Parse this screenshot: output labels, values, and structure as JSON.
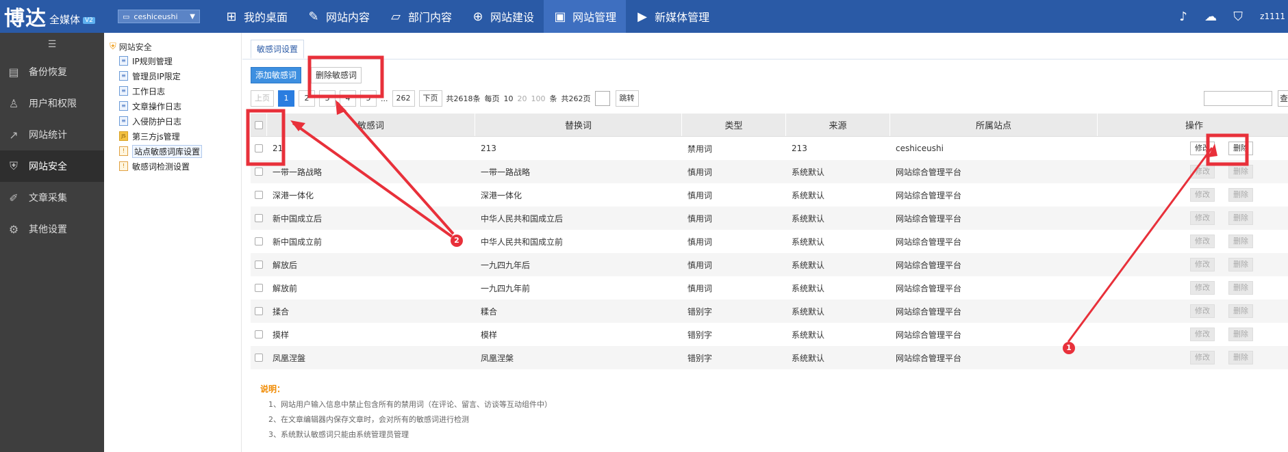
{
  "header": {
    "logo_main": "博达",
    "logo_sub": "全媒体",
    "logo_version": "V2",
    "site_selector": "ceshiceushi",
    "nav": [
      {
        "label": "我的桌面",
        "icon": "grid-icon"
      },
      {
        "label": "网站内容",
        "icon": "edit-icon"
      },
      {
        "label": "部门内容",
        "icon": "folder-icon"
      },
      {
        "label": "网站建设",
        "icon": "build-icon"
      },
      {
        "label": "网站管理",
        "icon": "monitor-icon",
        "active": true
      },
      {
        "label": "新媒体管理",
        "icon": "media-icon"
      }
    ],
    "username": "z1111"
  },
  "sidebar": {
    "items": [
      {
        "label": "备份恢复",
        "icon": "backup-icon"
      },
      {
        "label": "用户和权限",
        "icon": "user-icon"
      },
      {
        "label": "网站统计",
        "icon": "chart-icon"
      },
      {
        "label": "网站安全",
        "icon": "shield-icon",
        "active": true
      },
      {
        "label": "文章采集",
        "icon": "collect-icon"
      },
      {
        "label": "其他设置",
        "icon": "gear-icon"
      }
    ]
  },
  "tree": {
    "root": "网站安全",
    "items": [
      {
        "label": "IP规则管理",
        "icon": "doc-icon"
      },
      {
        "label": "管理员IP限定",
        "icon": "doc-icon"
      },
      {
        "label": "工作日志",
        "icon": "log-icon"
      },
      {
        "label": "文章操作日志",
        "icon": "log-icon"
      },
      {
        "label": "入侵防护日志",
        "icon": "log-icon"
      },
      {
        "label": "第三方js管理",
        "icon": "js-icon"
      },
      {
        "label": "站点敏感词库设置",
        "icon": "warn-icon",
        "selected": true
      },
      {
        "label": "敏感词检测设置",
        "icon": "warn-icon"
      }
    ]
  },
  "main": {
    "tab": "敏感词设置",
    "add_button": "添加敏感词",
    "delete_button": "删除敏感词",
    "pager": {
      "prev": "上页",
      "pages": [
        "1",
        "2",
        "3",
        "4",
        "5"
      ],
      "ellipsis": "...",
      "last": "262",
      "next": "下页",
      "total_text": "共2618条",
      "per_page_label": "每页",
      "sizes": [
        "10",
        "20",
        "100"
      ],
      "unit": "条",
      "pages_text": "共262页",
      "jump": "跳转"
    },
    "search_button": "查"
  },
  "table": {
    "headers": [
      "敏感词",
      "替换词",
      "类型",
      "来源",
      "所属站点",
      "操作"
    ],
    "edit_label": "修改",
    "delete_label": "删除",
    "rows": [
      {
        "word": "21",
        "replace": "213",
        "type": "禁用词",
        "source": "213",
        "site": "ceshiceushi",
        "enabled": true
      },
      {
        "word": "一带一路战略",
        "replace": "一带一路战略",
        "type": "慎用词",
        "source": "系统默认",
        "site": "网站综合管理平台",
        "enabled": false
      },
      {
        "word": "深港一体化",
        "replace": "深港一体化",
        "type": "慎用词",
        "source": "系统默认",
        "site": "网站综合管理平台",
        "enabled": false
      },
      {
        "word": "新中国成立后",
        "replace": "中华人民共和国成立后",
        "type": "慎用词",
        "source": "系统默认",
        "site": "网站综合管理平台",
        "enabled": false
      },
      {
        "word": "新中国成立前",
        "replace": "中华人民共和国成立前",
        "type": "慎用词",
        "source": "系统默认",
        "site": "网站综合管理平台",
        "enabled": false
      },
      {
        "word": "解放后",
        "replace": "一九四九年后",
        "type": "慎用词",
        "source": "系统默认",
        "site": "网站综合管理平台",
        "enabled": false
      },
      {
        "word": "解放前",
        "replace": "一九四九年前",
        "type": "慎用词",
        "source": "系统默认",
        "site": "网站综合管理平台",
        "enabled": false
      },
      {
        "word": "揉合",
        "replace": "糅合",
        "type": "错别字",
        "source": "系统默认",
        "site": "网站综合管理平台",
        "enabled": false
      },
      {
        "word": "摸样",
        "replace": "模样",
        "type": "错别字",
        "source": "系统默认",
        "site": "网站综合管理平台",
        "enabled": false
      },
      {
        "word": "凤凰涅盤",
        "replace": "凤凰涅槃",
        "type": "错别字",
        "source": "系统默认",
        "site": "网站综合管理平台",
        "enabled": false
      }
    ]
  },
  "notes": {
    "title": "说明：",
    "lines": [
      "1、网站用户输入信息中禁止包含所有的禁用词（在评论、留言、访谈等互动组件中）",
      "2、在文章编辑器内保存文章时，会对所有的敏感词进行检测",
      "3、系统默认敏感词只能由系统管理员管理"
    ]
  },
  "annotations": {
    "badge1": "1",
    "badge2": "2",
    "color": "#e8303a"
  }
}
